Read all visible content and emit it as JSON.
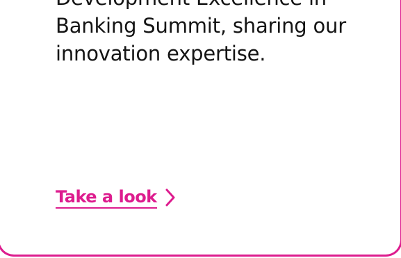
{
  "card": {
    "accent_color": "#dd1c8e",
    "text_color": "#141414",
    "body_lines": [
      "Development Excellence in",
      "Banking Summit, sharing our",
      "innovation expertise."
    ],
    "link": {
      "label": "Take a look",
      "icon": "chevron-right-icon"
    }
  }
}
